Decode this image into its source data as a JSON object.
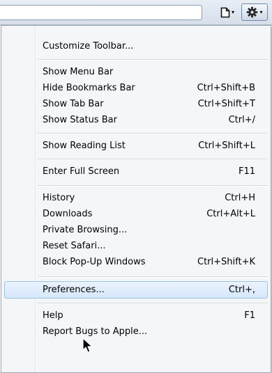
{
  "toolbar": {
    "page_icon": "page-icon",
    "gear_icon": "gear-icon",
    "dropdown_arrow": "▾"
  },
  "menu": {
    "items": [
      {
        "label": "Customize Toolbar...",
        "shortcut": ""
      },
      {
        "label": "Show Menu Bar",
        "shortcut": ""
      },
      {
        "label": "Hide Bookmarks Bar",
        "shortcut": "Ctrl+Shift+B"
      },
      {
        "label": "Show Tab Bar",
        "shortcut": "Ctrl+Shift+T"
      },
      {
        "label": "Show Status Bar",
        "shortcut": "Ctrl+/"
      },
      {
        "label": "Show Reading List",
        "shortcut": "Ctrl+Shift+L"
      },
      {
        "label": "Enter Full Screen",
        "shortcut": "F11"
      },
      {
        "label": "History",
        "shortcut": "Ctrl+H"
      },
      {
        "label": "Downloads",
        "shortcut": "Ctrl+Alt+L"
      },
      {
        "label": "Private Browsing...",
        "shortcut": ""
      },
      {
        "label": "Reset Safari...",
        "shortcut": ""
      },
      {
        "label": "Block Pop-Up Windows",
        "shortcut": "Ctrl+Shift+K"
      },
      {
        "label": "Preferences...",
        "shortcut": "Ctrl+,",
        "selected": true
      },
      {
        "label": "Help",
        "shortcut": "F1"
      },
      {
        "label": "Report Bugs to Apple...",
        "shortcut": ""
      }
    ]
  },
  "colors": {
    "highlight_border": "#9cc2ec",
    "menu_background": "#f5f6f7"
  },
  "cursor_icon": "mouse-pointer-icon"
}
